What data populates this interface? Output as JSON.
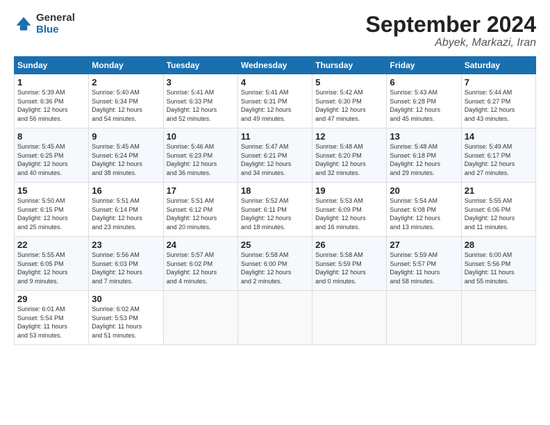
{
  "logo": {
    "general": "General",
    "blue": "Blue"
  },
  "header": {
    "month": "September 2024",
    "location": "Abyek, Markazi, Iran"
  },
  "weekdays": [
    "Sunday",
    "Monday",
    "Tuesday",
    "Wednesday",
    "Thursday",
    "Friday",
    "Saturday"
  ],
  "weeks": [
    [
      {
        "day": 1,
        "sunrise": "5:39 AM",
        "sunset": "6:36 PM",
        "daylight": "12 hours and 56 minutes."
      },
      {
        "day": 2,
        "sunrise": "5:40 AM",
        "sunset": "6:34 PM",
        "daylight": "12 hours and 54 minutes."
      },
      {
        "day": 3,
        "sunrise": "5:41 AM",
        "sunset": "6:33 PM",
        "daylight": "12 hours and 52 minutes."
      },
      {
        "day": 4,
        "sunrise": "5:41 AM",
        "sunset": "6:31 PM",
        "daylight": "12 hours and 49 minutes."
      },
      {
        "day": 5,
        "sunrise": "5:42 AM",
        "sunset": "6:30 PM",
        "daylight": "12 hours and 47 minutes."
      },
      {
        "day": 6,
        "sunrise": "5:43 AM",
        "sunset": "6:28 PM",
        "daylight": "12 hours and 45 minutes."
      },
      {
        "day": 7,
        "sunrise": "5:44 AM",
        "sunset": "6:27 PM",
        "daylight": "12 hours and 43 minutes."
      }
    ],
    [
      {
        "day": 8,
        "sunrise": "5:45 AM",
        "sunset": "6:25 PM",
        "daylight": "12 hours and 40 minutes."
      },
      {
        "day": 9,
        "sunrise": "5:45 AM",
        "sunset": "6:24 PM",
        "daylight": "12 hours and 38 minutes."
      },
      {
        "day": 10,
        "sunrise": "5:46 AM",
        "sunset": "6:23 PM",
        "daylight": "12 hours and 36 minutes."
      },
      {
        "day": 11,
        "sunrise": "5:47 AM",
        "sunset": "6:21 PM",
        "daylight": "12 hours and 34 minutes."
      },
      {
        "day": 12,
        "sunrise": "5:48 AM",
        "sunset": "6:20 PM",
        "daylight": "12 hours and 32 minutes."
      },
      {
        "day": 13,
        "sunrise": "5:48 AM",
        "sunset": "6:18 PM",
        "daylight": "12 hours and 29 minutes."
      },
      {
        "day": 14,
        "sunrise": "5:49 AM",
        "sunset": "6:17 PM",
        "daylight": "12 hours and 27 minutes."
      }
    ],
    [
      {
        "day": 15,
        "sunrise": "5:50 AM",
        "sunset": "6:15 PM",
        "daylight": "12 hours and 25 minutes."
      },
      {
        "day": 16,
        "sunrise": "5:51 AM",
        "sunset": "6:14 PM",
        "daylight": "12 hours and 23 minutes."
      },
      {
        "day": 17,
        "sunrise": "5:51 AM",
        "sunset": "6:12 PM",
        "daylight": "12 hours and 20 minutes."
      },
      {
        "day": 18,
        "sunrise": "5:52 AM",
        "sunset": "6:11 PM",
        "daylight": "12 hours and 18 minutes."
      },
      {
        "day": 19,
        "sunrise": "5:53 AM",
        "sunset": "6:09 PM",
        "daylight": "12 hours and 16 minutes."
      },
      {
        "day": 20,
        "sunrise": "5:54 AM",
        "sunset": "6:08 PM",
        "daylight": "12 hours and 13 minutes."
      },
      {
        "day": 21,
        "sunrise": "5:55 AM",
        "sunset": "6:06 PM",
        "daylight": "12 hours and 11 minutes."
      }
    ],
    [
      {
        "day": 22,
        "sunrise": "5:55 AM",
        "sunset": "6:05 PM",
        "daylight": "12 hours and 9 minutes."
      },
      {
        "day": 23,
        "sunrise": "5:56 AM",
        "sunset": "6:03 PM",
        "daylight": "12 hours and 7 minutes."
      },
      {
        "day": 24,
        "sunrise": "5:57 AM",
        "sunset": "6:02 PM",
        "daylight": "12 hours and 4 minutes."
      },
      {
        "day": 25,
        "sunrise": "5:58 AM",
        "sunset": "6:00 PM",
        "daylight": "12 hours and 2 minutes."
      },
      {
        "day": 26,
        "sunrise": "5:58 AM",
        "sunset": "5:59 PM",
        "daylight": "12 hours and 0 minutes."
      },
      {
        "day": 27,
        "sunrise": "5:59 AM",
        "sunset": "5:57 PM",
        "daylight": "11 hours and 58 minutes."
      },
      {
        "day": 28,
        "sunrise": "6:00 AM",
        "sunset": "5:56 PM",
        "daylight": "11 hours and 55 minutes."
      }
    ],
    [
      {
        "day": 29,
        "sunrise": "6:01 AM",
        "sunset": "5:54 PM",
        "daylight": "11 hours and 53 minutes."
      },
      {
        "day": 30,
        "sunrise": "6:02 AM",
        "sunset": "5:53 PM",
        "daylight": "11 hours and 51 minutes."
      },
      null,
      null,
      null,
      null,
      null
    ]
  ]
}
